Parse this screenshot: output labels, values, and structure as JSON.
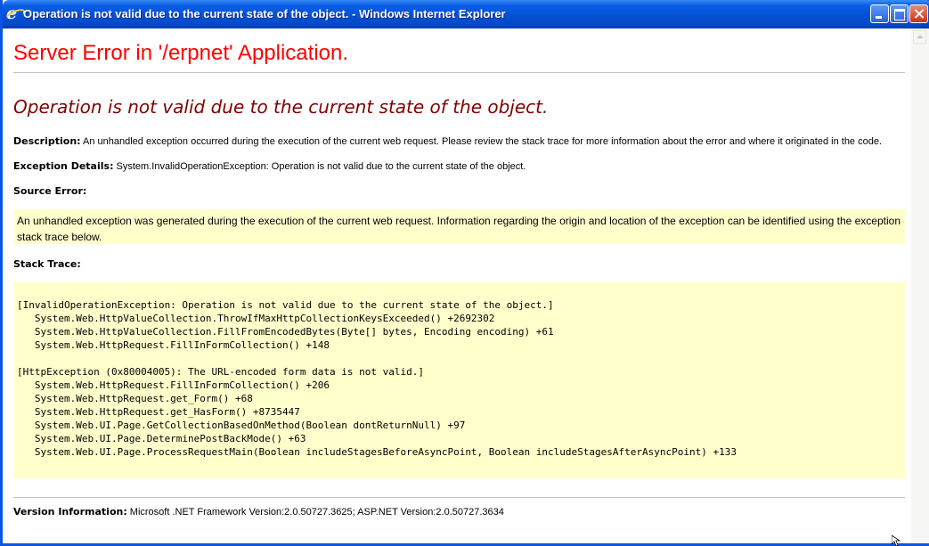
{
  "window": {
    "title": "Operation is not valid due to the current state of the object. - Windows Internet Explorer"
  },
  "page": {
    "heading": "Server Error in '/erpnet' Application.",
    "error_title": "Operation is not valid due to the current state of the object.",
    "description_label": "Description:",
    "description_text": " An unhandled exception occurred during the execution of the current web request. Please review the stack trace for more information about the error and where it originated in the code.",
    "exception_label": "Exception Details:",
    "exception_text": " System.InvalidOperationException: Operation is not valid due to the current state of the object.",
    "source_error_label": "Source Error:",
    "source_error_text": "An unhandled exception was generated during the execution of the current web request. Information regarding the origin and location of the exception can be identified using the exception stack trace below.",
    "stack_trace_label": "Stack Trace:",
    "stack_trace": {
      "block1": [
        "[InvalidOperationException: Operation is not valid due to the current state of the object.]",
        "   System.Web.HttpValueCollection.ThrowIfMaxHttpCollectionKeysExceeded() +2692302",
        "   System.Web.HttpValueCollection.FillFromEncodedBytes(Byte[] bytes, Encoding encoding) +61",
        "   System.Web.HttpRequest.FillInFormCollection() +148"
      ],
      "block2": [
        "[HttpException (0x80004005): The URL-encoded form data is not valid.]",
        "   System.Web.HttpRequest.FillInFormCollection() +206",
        "   System.Web.HttpRequest.get_Form() +68",
        "   System.Web.HttpRequest.get_HasForm() +8735447",
        "   System.Web.UI.Page.GetCollectionBasedOnMethod(Boolean dontReturnNull) +97",
        "   System.Web.UI.Page.DeterminePostBackMode() +63",
        "   System.Web.UI.Page.ProcessRequestMain(Boolean includeStagesBeforeAsyncPoint, Boolean includeStagesAfterAsyncPoint) +133"
      ]
    },
    "version_label": "Version Information:",
    "version_text": " Microsoft .NET Framework Version:2.0.50727.3625; ASP.NET Version:2.0.50727.3634"
  },
  "colors": {
    "heading": "#ff0000",
    "error_title": "#800000",
    "box_background": "#ffffcc",
    "titlebar": "#0552d8"
  },
  "icons": {
    "app": "ie-icon",
    "minimize": "minimize-icon",
    "maximize": "maximize-icon",
    "close": "close-icon",
    "scroll_up": "scroll-up-arrow-icon",
    "cursor": "mouse-cursor-icon"
  }
}
